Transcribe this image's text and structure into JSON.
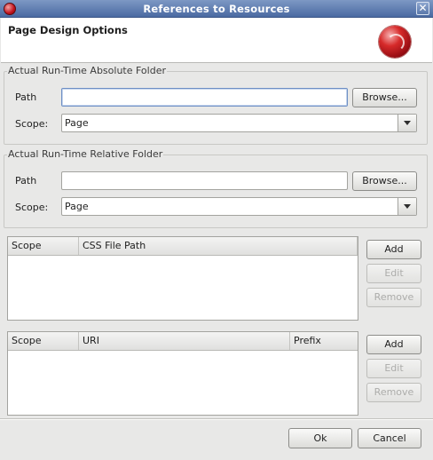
{
  "window": {
    "title": "References to Resources",
    "close_glyph": "✕"
  },
  "banner": {
    "heading": "Page Design Options"
  },
  "absolute_folder": {
    "legend": "Actual Run-Time Absolute Folder",
    "path_label": "Path",
    "path_value": "",
    "browse_label": "Browse...",
    "scope_label": "Scope:",
    "scope_value": "Page"
  },
  "relative_folder": {
    "legend": "Actual Run-Time Relative Folder",
    "path_label": "Path",
    "path_value": "",
    "browse_label": "Browse...",
    "scope_label": "Scope:",
    "scope_value": "Page"
  },
  "css_table": {
    "columns": [
      "Scope",
      "CSS File Path"
    ],
    "rows": [],
    "add_label": "Add",
    "edit_label": "Edit",
    "remove_label": "Remove"
  },
  "uri_table": {
    "columns": [
      "Scope",
      "URI",
      "Prefix"
    ],
    "rows": [],
    "add_label": "Add",
    "edit_label": "Edit",
    "remove_label": "Remove"
  },
  "footer": {
    "ok_label": "Ok",
    "cancel_label": "Cancel"
  },
  "icons": {
    "app": "app-logo-icon",
    "banner": "banner-logo-icon",
    "close": "close-icon",
    "dropdown": "chevron-down-icon"
  }
}
